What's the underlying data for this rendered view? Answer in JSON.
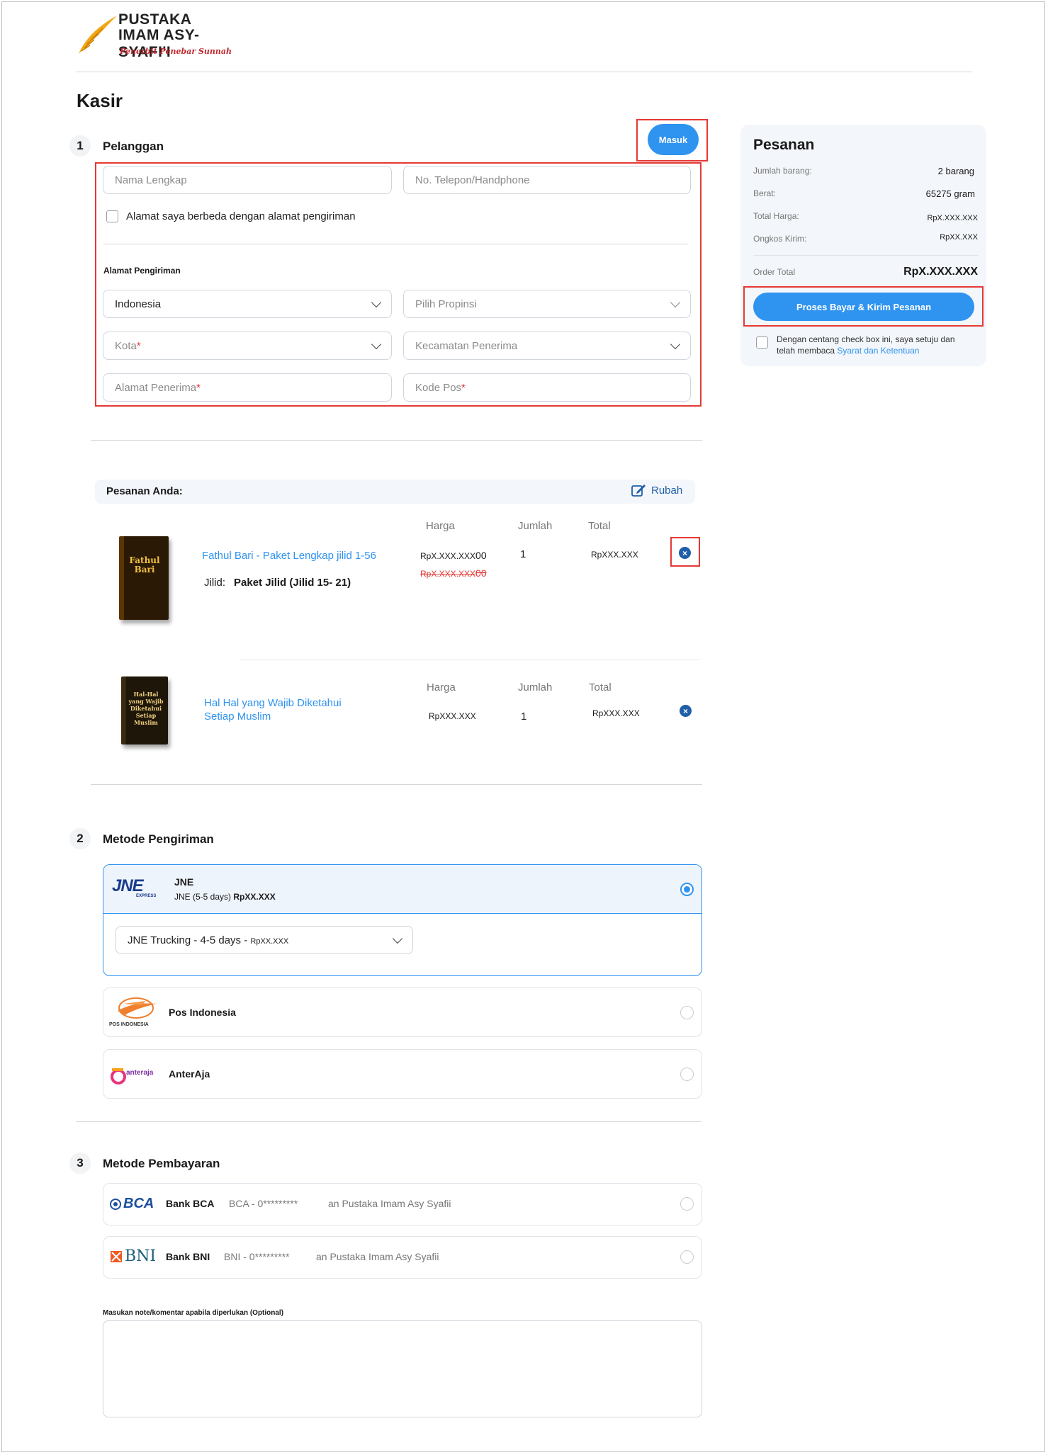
{
  "brand": {
    "line1": "PUSTAKA",
    "line2": "IMAM ASY-SYAFI'I",
    "tagline": "Penerbit Penebar Sunnah"
  },
  "page_title": "Kasir",
  "customer": {
    "step": "1",
    "title": "Pelanggan",
    "login_button": "Masuk",
    "name_placeholder": "Nama Lengkap",
    "phone_placeholder": "No. Telepon/Handphone",
    "different_address_label": "Alamat saya berbeda dengan alamat pengiriman",
    "shipping_address_title": "Alamat Pengiriman",
    "country_value": "Indonesia",
    "province_placeholder": "Pilih Propinsi",
    "city_placeholder": "Kota",
    "district_placeholder": "Kecamatan Penerima",
    "address_placeholder": "Alamat Penerima",
    "postal_placeholder": "Kode Pos",
    "required_mark": "*"
  },
  "order": {
    "title": "Pesanan Anda:",
    "edit_label": "Rubah",
    "col_price": "Harga",
    "col_qty": "Jumlah",
    "col_total": "Total",
    "items": [
      {
        "name": "Fathul Bari - Paket Lengkap jilid 1-56",
        "variant_label": "Jilid:",
        "variant_value": "Paket Jilid (Jilid 15- 21)",
        "price": "RpX.XXX.XXX",
        "price_suffix": "00",
        "old_price": "RpX.XXX.XXX",
        "old_price_suffix": "00",
        "qty": "1",
        "total": "RpXXX.XXX",
        "cover_title": "Fathul Bari"
      },
      {
        "name": "Hal Hal yang Wajib Diketahui Setiap Muslim",
        "price": "RpXXX.XXX",
        "qty": "1",
        "total": "RpXXX.XXX",
        "cover_title": "Hal-Hal yang Wajib Diketahui Setiap Muslim"
      }
    ]
  },
  "shipping": {
    "step": "2",
    "title": "Metode Pengiriman",
    "options": [
      {
        "name": "JNE",
        "logo": "JNE",
        "logo_sub": "EXPRESS",
        "detail": "JNE (5-5 days)",
        "price": "RpXX.XXX",
        "selected": true
      },
      {
        "name": "Pos Indonesia",
        "logo_sub": "POS INDONESIA",
        "selected": false
      },
      {
        "name": "AnterAja",
        "logo": "anteraja",
        "selected": false
      }
    ],
    "service_value": "JNE Trucking - 4-5 days -",
    "service_price": "RpXX.XXX"
  },
  "payment": {
    "step": "3",
    "title": "Metode Pembayaran",
    "options": [
      {
        "logo": "BCA",
        "name": "Bank BCA",
        "account": "BCA - 0*********",
        "holder": "an Pustaka Imam Asy Syafii"
      },
      {
        "logo": "BNI",
        "name": "Bank BNI",
        "account": "BNI - 0*********",
        "holder": "an Pustaka Imam Asy Syafii"
      }
    ],
    "note_label": "Masukan note/komentar apabila diperlukan (Optional)"
  },
  "summary": {
    "title": "Pesanan",
    "rows": [
      {
        "label": "Jumlah barang:",
        "value": "2 barang"
      },
      {
        "label": "Berat:",
        "value": "65275 gram"
      },
      {
        "label": "Total Harga:",
        "value": "RpX.XXX.XXX"
      },
      {
        "label": "Ongkos Kirim:",
        "value": "RpXX.XXX"
      }
    ],
    "total_label": "Order Total",
    "total_value": "RpX.XXX.XXX",
    "checkout_button": "Proses Bayar & Kirim Pesanan",
    "terms_text": "Dengan centang check box ini, saya setuju dan telah membaca",
    "terms_link": "Syarat dan Ketentuan"
  },
  "colors": {
    "accent": "#2f93f0",
    "annotation": "#e53935",
    "link": "#2f93f0"
  }
}
